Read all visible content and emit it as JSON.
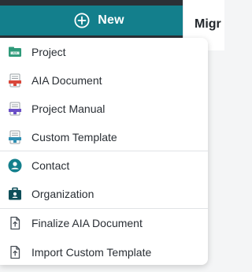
{
  "new_button": {
    "label": "New",
    "icon": "plus-circle-icon",
    "color": "#137f8c"
  },
  "right_header": {
    "title": "Migr"
  },
  "menu": {
    "sections": [
      {
        "items": [
          {
            "label": "Project",
            "icon": "project-icon"
          },
          {
            "label": "AIA Document",
            "icon": "aia-document-icon"
          },
          {
            "label": "Project Manual",
            "icon": "project-manual-icon"
          },
          {
            "label": "Custom Template",
            "icon": "custom-template-icon"
          }
        ]
      },
      {
        "items": [
          {
            "label": "Contact",
            "icon": "contact-icon"
          },
          {
            "label": "Organization",
            "icon": "organization-icon"
          }
        ]
      },
      {
        "items": [
          {
            "label": "Finalize AIA Document",
            "icon": "upload-file-icon"
          },
          {
            "label": "Import Custom Template",
            "icon": "upload-file-icon"
          }
        ]
      }
    ]
  },
  "colors": {
    "accent": "#137f8c",
    "dark_bar": "#2b3036"
  }
}
